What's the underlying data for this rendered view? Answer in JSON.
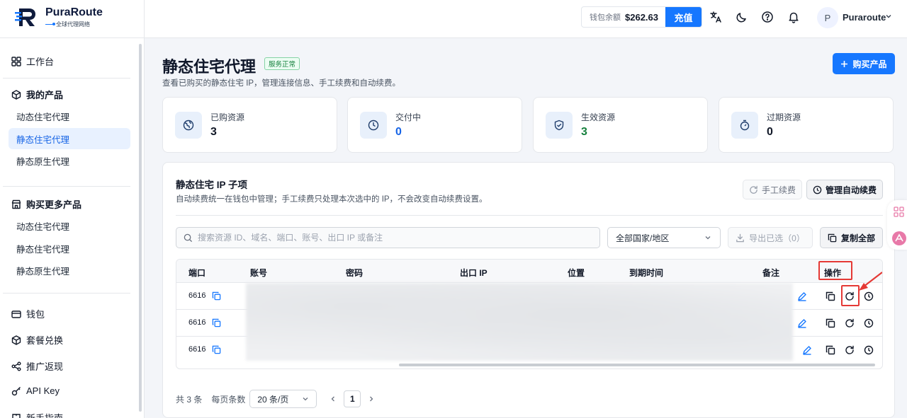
{
  "brand": {
    "name": "PuraRoute",
    "tagline": "全球代理网络"
  },
  "topbar": {
    "wallet_label": "钱包余额",
    "wallet_amount": "$262.63",
    "recharge_label": "充值",
    "avatar_initial": "P",
    "user_name": "Puraroute"
  },
  "sidebar": {
    "workbench": "工作台",
    "my_products": "我的产品",
    "my_products_items": [
      "动态住宅代理",
      "静态住宅代理",
      "静态原生代理"
    ],
    "buy_more": "购买更多产品",
    "buy_more_items": [
      "动态住宅代理",
      "静态住宅代理",
      "静态原生代理"
    ],
    "wallet": "钱包",
    "plan_exchange": "套餐兑换",
    "referral": "推广返现",
    "api_key": "API Key",
    "guide": "新手指南"
  },
  "page": {
    "title": "静态住宅代理",
    "status": "服务正常",
    "desc": "查看已购买的静态住宅 IP，管理连接信息、手工续费和自动续费。",
    "buy_label": "购买产品"
  },
  "stats": [
    {
      "label": "已购资源",
      "value": "3",
      "color": "#111827"
    },
    {
      "label": "交付中",
      "value": "0",
      "color": "#1664e6"
    },
    {
      "label": "生效资源",
      "value": "3",
      "color": "#15803d"
    },
    {
      "label": "过期资源",
      "value": "0",
      "color": "#111827"
    }
  ],
  "panel": {
    "title": "静态住宅 IP 子项",
    "desc": "自动续费统一在钱包中管理；手工续费只处理本次选中的 IP，不会改变自动续费设置。",
    "manual_renew": "手工续费",
    "manage_auto": "管理自动续费",
    "search_placeholder": "搜索资源 ID、域名、端口、账号、出口 IP 或备注",
    "country_select": "全部国家/地区",
    "export_label": "导出已选（0）",
    "copy_all": "复制全部"
  },
  "table": {
    "headers": {
      "port": "端口",
      "account": "账号",
      "password": "密码",
      "exit_ip": "出口 IP",
      "location": "位置",
      "expiry": "到期时间",
      "note": "备注",
      "actions": "操作"
    },
    "rows": [
      {
        "port": "6616"
      },
      {
        "port": "6616"
      },
      {
        "port": "6616"
      }
    ]
  },
  "pagination": {
    "total": "共 3 条",
    "page_size_label": "每页条数",
    "page_size": "20 条/页",
    "current_page": "1"
  },
  "icons": [
    "translate-icon",
    "moon-icon",
    "help-icon",
    "bell-icon",
    "copy-icon",
    "renew-icon",
    "clock-icon",
    "edit-icon"
  ],
  "accent": "#1677ff",
  "highlight": "#e53935"
}
